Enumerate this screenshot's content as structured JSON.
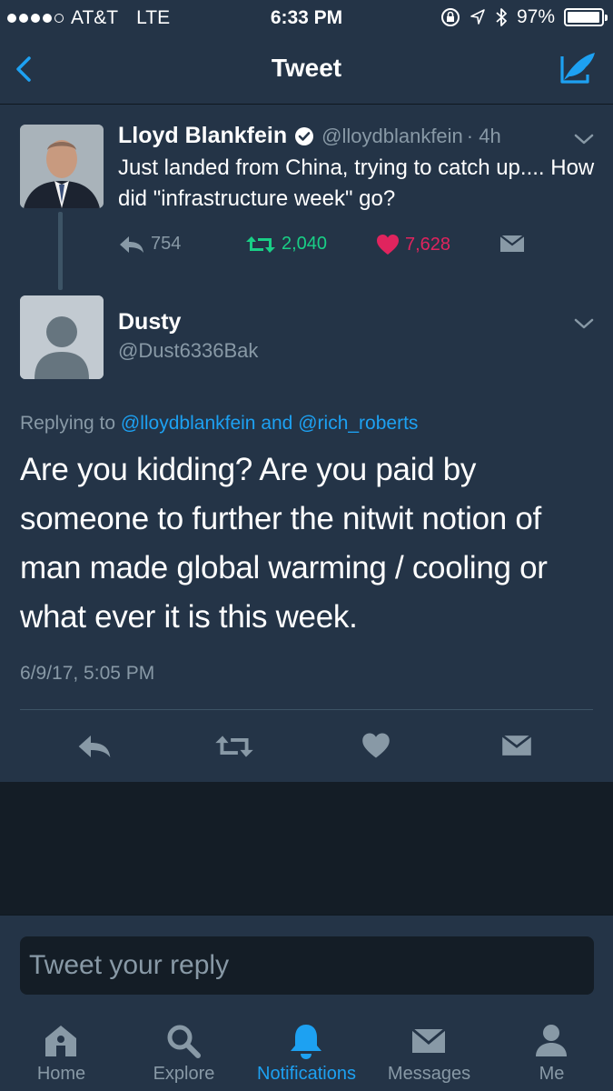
{
  "status_bar": {
    "carrier": "AT&T",
    "network": "LTE",
    "time": "6:33 PM",
    "battery": "97%",
    "battery_level": 0.97
  },
  "nav": {
    "title": "Tweet",
    "back_icon": "chevron-left-icon",
    "compose_icon": "compose-tweet-icon",
    "accent_color": "#1da1f2"
  },
  "original_tweet": {
    "name": "Lloyd Blankfein",
    "verified": true,
    "handle": "@lloydblankfein",
    "time_ago": "· 4h",
    "text": "Just landed from China, trying to catch up.... How did \"infrastructure week\" go?",
    "replies": "754",
    "retweets": "2,040",
    "likes": "7,628",
    "retweet_color": "#19cf86",
    "like_color": "#e0245e"
  },
  "reply_tweet": {
    "name": "Dusty",
    "handle": "@Dust6336Bak",
    "replying_prefix": "Replying to",
    "replying_user1": "@lloydblankfein",
    "replying_and": "and",
    "replying_user2": "@rich_roberts",
    "text": "Are you kidding? Are you paid by someone to further the nitwit notion of man made global warming / cooling  or what ever it is this week.",
    "timestamp": "6/9/17, 5:05 PM"
  },
  "reply_box": {
    "placeholder": "Tweet your reply"
  },
  "tabs": [
    {
      "label": "Home",
      "icon": "home-icon",
      "active": false
    },
    {
      "label": "Explore",
      "icon": "search-icon",
      "active": false
    },
    {
      "label": "Notifications",
      "icon": "bell-icon",
      "active": true
    },
    {
      "label": "Messages",
      "icon": "envelope-icon",
      "active": false
    },
    {
      "label": "Me",
      "icon": "person-icon",
      "active": false
    }
  ]
}
